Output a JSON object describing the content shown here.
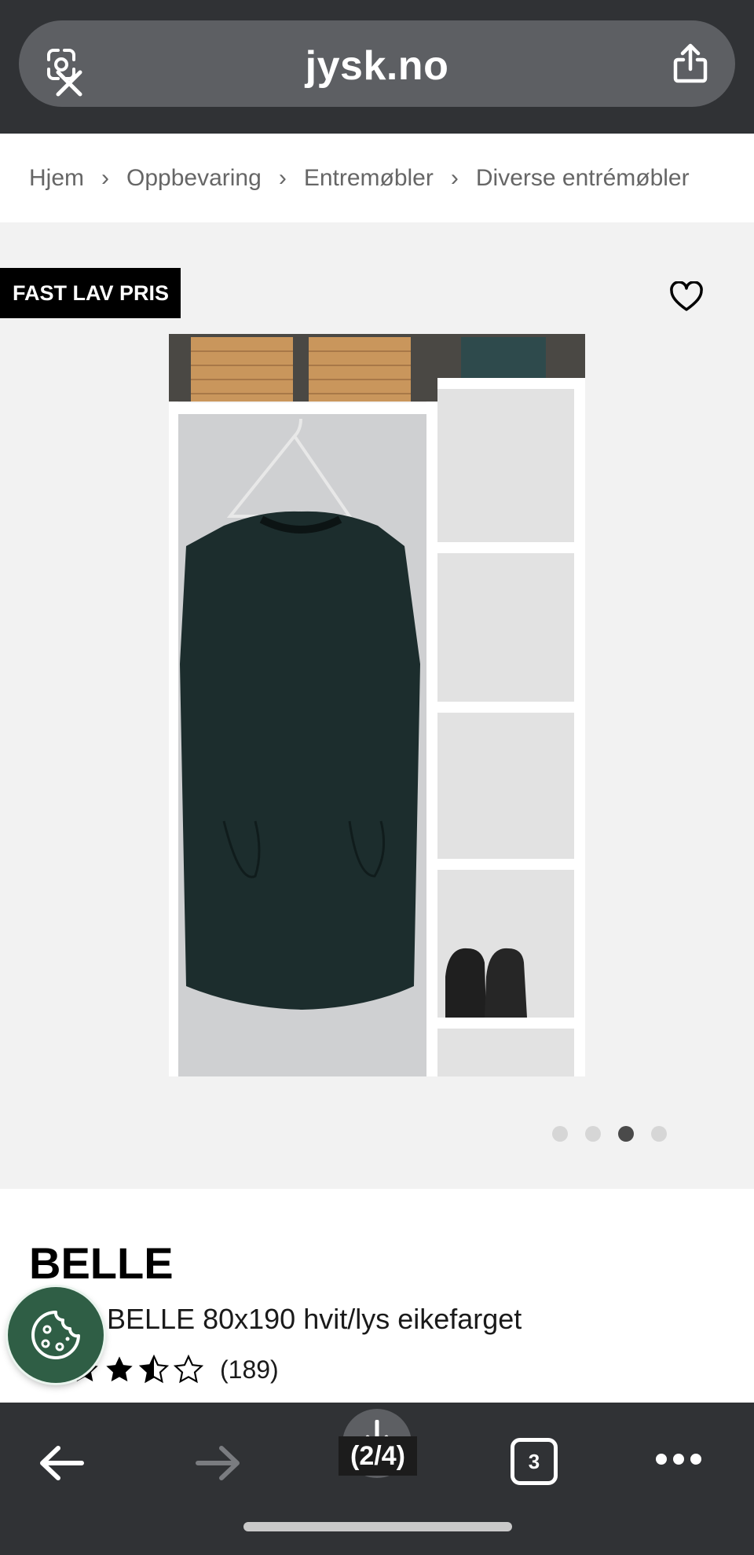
{
  "browser": {
    "url": "jysk.no",
    "page_indicator": "(2/4)",
    "tab_count": "3"
  },
  "breadcrumb": {
    "items": [
      "Hjem",
      "Oppbevaring",
      "Entremøbler",
      "Diverse entrémøbler"
    ]
  },
  "product": {
    "badge": "FAST LAV PRIS",
    "brand": "BELLE",
    "subtitle": "BELLE 80x190 hvit/lys eikefarget",
    "rating_value": 3.5,
    "rating_max": 5,
    "review_count": "(189)"
  },
  "gallery": {
    "total_images": 4,
    "active_index": 2
  },
  "icons": {
    "lens": "camera-lens-icon",
    "close": "close-icon",
    "share": "share-icon",
    "wishlist": "heart-icon",
    "cookie": "cookie-icon",
    "back": "arrow-left-icon",
    "forward": "arrow-right-icon",
    "download": "download-icon",
    "tabs": "tabs-icon",
    "more": "more-dots-icon"
  },
  "colors": {
    "chrome": "#303235",
    "url_pill": "#5d5f63",
    "badge_bg": "#000000",
    "cookie_bg": "#2f5e45"
  }
}
